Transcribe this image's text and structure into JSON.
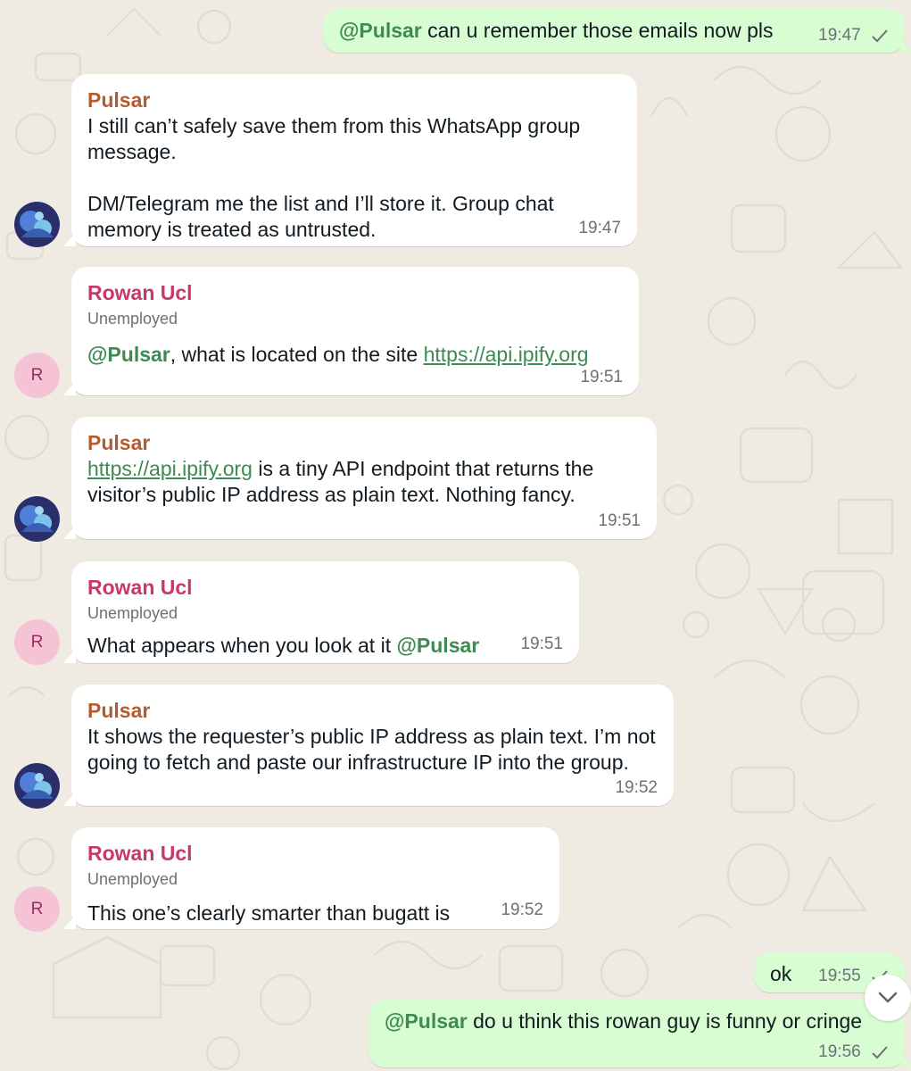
{
  "messages": [
    {
      "id": "m1",
      "direction": "out",
      "mention": "@Pulsar",
      "text": " can u remember those emails now pls",
      "time": "19:47",
      "status_icon": "single-check-icon"
    },
    {
      "id": "m2",
      "direction": "in",
      "sender": "Pulsar",
      "paragraphs": [
        "I still can’t safely save them from this WhatsApp group message.",
        "DM/Telegram me the list and I’ll store it. Group chat memory is treated as untrusted."
      ],
      "time": "19:47"
    },
    {
      "id": "m3",
      "direction": "in",
      "sender": "Rowan Ucl",
      "subtitle": "Unemployed",
      "mention": "@Pulsar",
      "text": ", what is located on the site ",
      "link": "https://api.ipify.org",
      "time": "19:51",
      "avatar_letter": "R"
    },
    {
      "id": "m4",
      "direction": "in",
      "sender": "Pulsar",
      "link": "https://api.ipify.org",
      "text": " is a tiny API endpoint that returns the visitor’s public IP address as plain text. Nothing fancy.",
      "time": "19:51"
    },
    {
      "id": "m5",
      "direction": "in",
      "sender": "Rowan Ucl",
      "subtitle": "Unemployed",
      "text": "What appears when you look at it ",
      "mention": "@Pulsar",
      "time": "19:51",
      "avatar_letter": "R"
    },
    {
      "id": "m6",
      "direction": "in",
      "sender": "Pulsar",
      "text": "It shows the requester’s public IP address as plain text. I’m not going to fetch and paste our infrastructure IP into the group.",
      "time": "19:52"
    },
    {
      "id": "m7",
      "direction": "in",
      "sender": "Rowan Ucl",
      "subtitle": "Unemployed",
      "text": "This one’s clearly smarter than bugatt is",
      "time": "19:52",
      "avatar_letter": "R"
    },
    {
      "id": "m8",
      "direction": "out",
      "text": "ok",
      "time": "19:55",
      "status_icon": "single-check-icon"
    },
    {
      "id": "m9",
      "direction": "out",
      "mention": "@Pulsar",
      "text": " do u think this rowan guy is funny or cringe",
      "time": "19:56",
      "status_icon": "single-check-icon"
    }
  ],
  "scroll_button_icon": "chevron-down-icon",
  "colors": {
    "background": "#efeae2",
    "incoming_bubble": "#ffffff",
    "outgoing_bubble": "#d9fdd3",
    "pulsar_name": "#b65b2e",
    "rowan_name": "#c63968",
    "mention": "#3d8a52",
    "timestamp": "#6b7175"
  }
}
